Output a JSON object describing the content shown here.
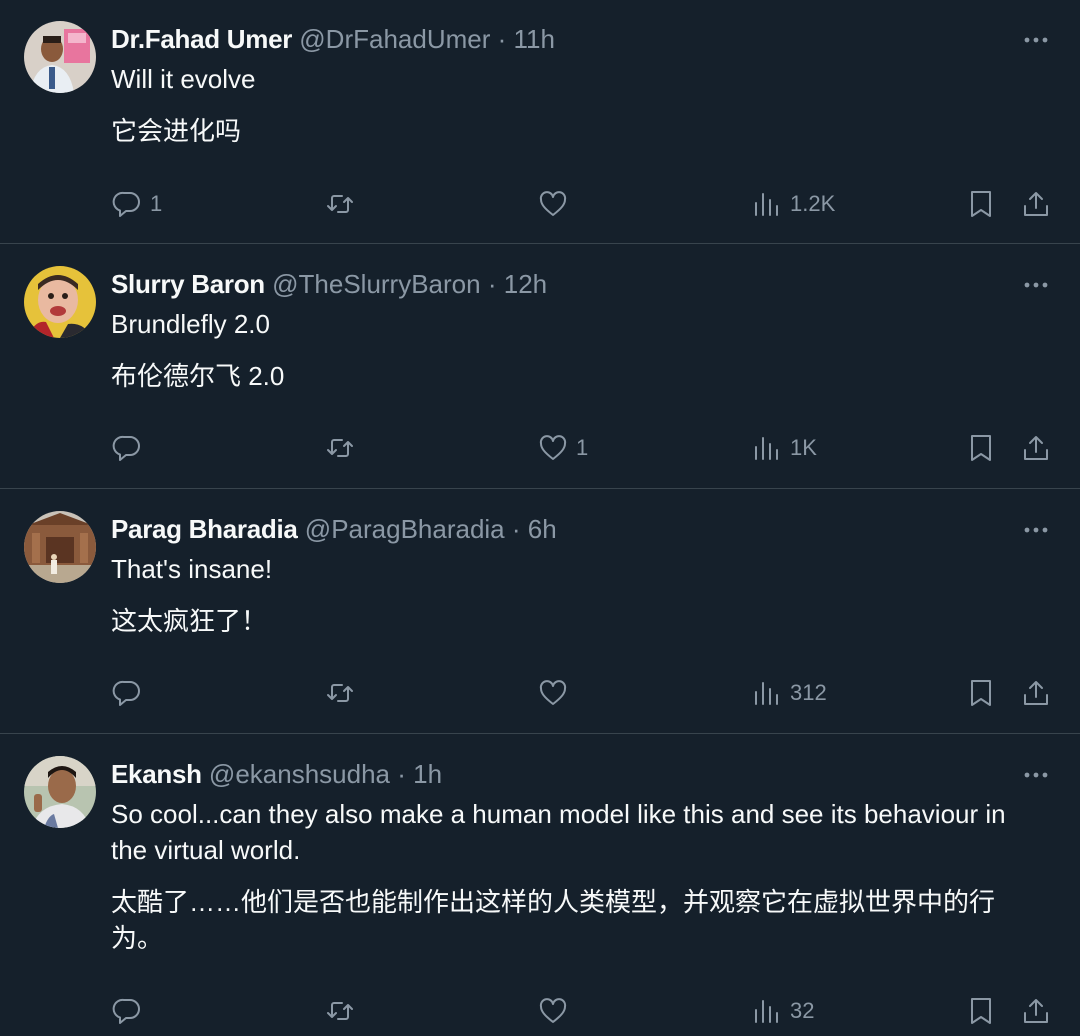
{
  "colors": {
    "background": "#15202b",
    "text": "#f7f9f9",
    "muted": "#8b98a5",
    "divider": "#38444d"
  },
  "tweets": [
    {
      "name": "Dr.Fahad Umer",
      "handle": "@DrFahadUmer",
      "dot": "·",
      "time": "11h",
      "text_en": "Will it evolve",
      "text_zh": "它会进化吗",
      "replies": "1",
      "retweets": "",
      "likes": "",
      "views": "1.2K"
    },
    {
      "name": "Slurry Baron",
      "handle": "@TheSlurryBaron",
      "dot": "·",
      "time": "12h",
      "text_en": "Brundlefly 2.0",
      "text_zh": "布伦德尔飞 2.0",
      "replies": "",
      "retweets": "",
      "likes": "1",
      "views": "1K"
    },
    {
      "name": "Parag Bharadia",
      "handle": "@ParagBharadia",
      "dot": "·",
      "time": "6h",
      "text_en": "That's insane!",
      "text_zh": "这太疯狂了！",
      "replies": "",
      "retweets": "",
      "likes": "",
      "views": "312"
    },
    {
      "name": "Ekansh",
      "handle": "@ekanshsudha",
      "dot": "·",
      "time": "1h",
      "text_en": "So cool...can they also make a human model like this and see its behaviour in the virtual world.",
      "text_zh": "太酷了……他们是否也能制作出这样的人类模型，并观察它在虚拟世界中的行为。",
      "replies": "",
      "retweets": "",
      "likes": "",
      "views": "32"
    }
  ],
  "icons": {
    "more": "more-icon",
    "reply": "reply-icon",
    "retweet": "retweet-icon",
    "like": "heart-icon",
    "views": "views-icon",
    "bookmark": "bookmark-icon",
    "share": "share-icon"
  }
}
